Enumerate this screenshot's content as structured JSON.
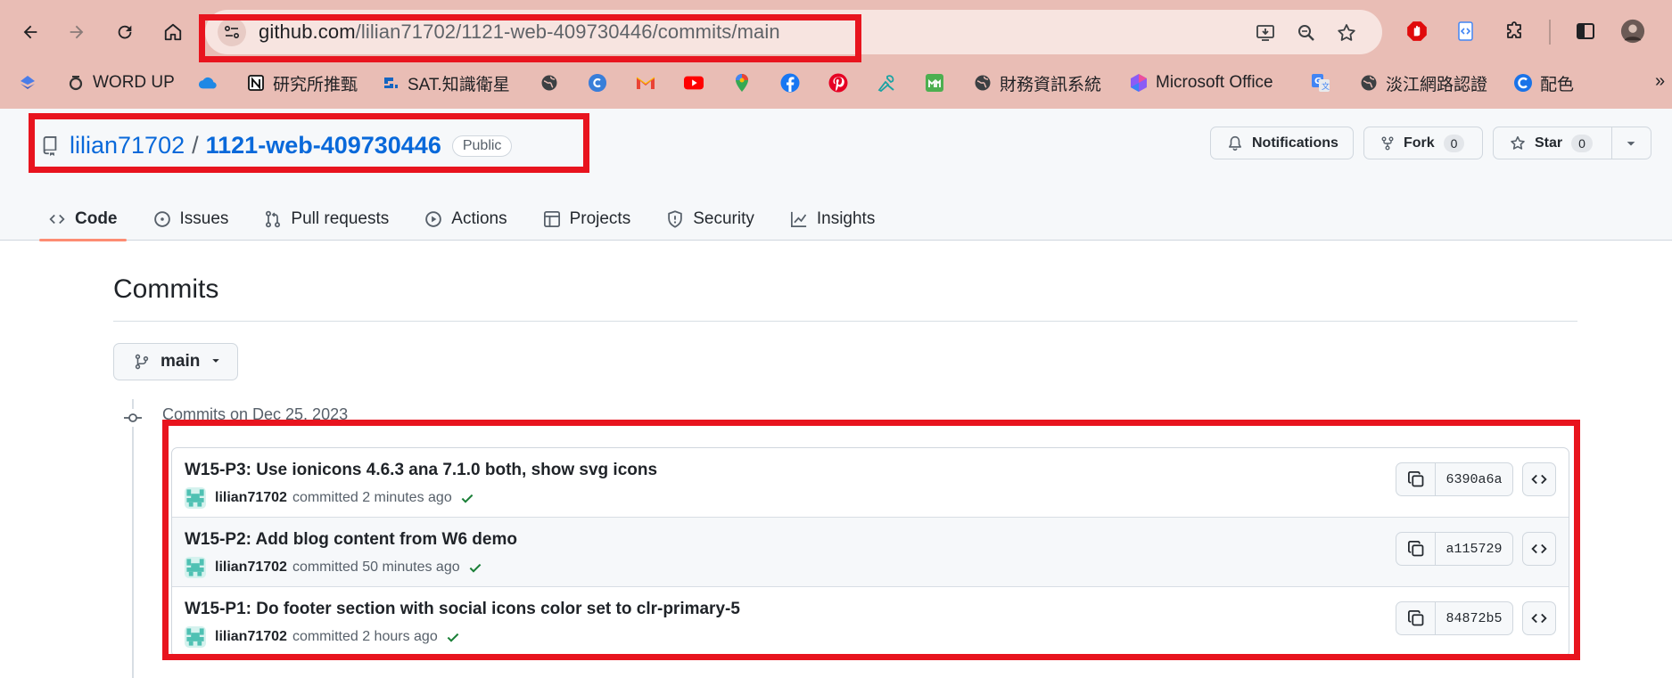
{
  "browser": {
    "url_host": "github.com",
    "url_path": "/lilian71702/1121-web-409730446/commits/main",
    "bookmarks": [
      {
        "label": "",
        "icon": "blue-diamond-icon"
      },
      {
        "label": "WORD UP",
        "icon": "word-up-icon"
      },
      {
        "label": "",
        "icon": "onedrive-icon"
      },
      {
        "label": "研究所推甄",
        "icon": "notion-icon"
      },
      {
        "label": "SAT.知識衛星",
        "icon": "sat-icon"
      },
      {
        "label": "",
        "icon": "globe-icon"
      },
      {
        "label": "",
        "icon": "canva-icon"
      },
      {
        "label": "",
        "icon": "gmail-icon"
      },
      {
        "label": "",
        "icon": "youtube-icon"
      },
      {
        "label": "",
        "icon": "maps-icon"
      },
      {
        "label": "",
        "icon": "facebook-icon"
      },
      {
        "label": "",
        "icon": "pinterest-icon"
      },
      {
        "label": "",
        "icon": "tool-icon"
      },
      {
        "label": "",
        "icon": "moodle-icon"
      },
      {
        "label": "財務資訊系統",
        "icon": "globe-icon"
      },
      {
        "label": "Microsoft Office",
        "icon": "office-icon"
      },
      {
        "label": "",
        "icon": "translate-icon"
      },
      {
        "label": "淡江網路認證",
        "icon": "globe-icon"
      },
      {
        "label": "配色",
        "icon": "colorful-icon"
      }
    ],
    "bookmarks_more": "»"
  },
  "repo": {
    "owner": "lilian71702",
    "slash": "/",
    "name": "1121-web-409730446",
    "visibility": "Public",
    "notifications_label": "Notifications",
    "fork_label": "Fork",
    "fork_count": "0",
    "star_label": "Star",
    "star_count": "0"
  },
  "tabs": [
    {
      "label": "Code",
      "icon": "code-icon",
      "active": true
    },
    {
      "label": "Issues",
      "icon": "issue-icon"
    },
    {
      "label": "Pull requests",
      "icon": "pull-request-icon"
    },
    {
      "label": "Actions",
      "icon": "play-icon"
    },
    {
      "label": "Projects",
      "icon": "table-icon"
    },
    {
      "label": "Security",
      "icon": "shield-icon"
    },
    {
      "label": "Insights",
      "icon": "graph-icon"
    }
  ],
  "page": {
    "title": "Commits",
    "branch": "main",
    "group_label": "Commits on Dec 25, 2023"
  },
  "commits": [
    {
      "message": "W15-P3: Use ionicons 4.6.3 ana 7.1.0 both, show svg icons",
      "author": "lilian71702",
      "action": "committed",
      "time": "2 minutes ago",
      "sha": "6390a6a"
    },
    {
      "message": "W15-P2: Add blog content from W6 demo",
      "author": "lilian71702",
      "action": "committed",
      "time": "50 minutes ago",
      "sha": "a115729"
    },
    {
      "message": "W15-P1: Do footer section with social icons color set to clr-primary-5",
      "author": "lilian71702",
      "action": "committed",
      "time": "2 hours ago",
      "sha": "84872b5"
    }
  ],
  "colors": {
    "chrome_bg": "#e9bdb5",
    "link": "#0969da",
    "highlight": "#e8141e",
    "active_tab_underline": "#fd8c73",
    "success": "#1a7f37"
  }
}
